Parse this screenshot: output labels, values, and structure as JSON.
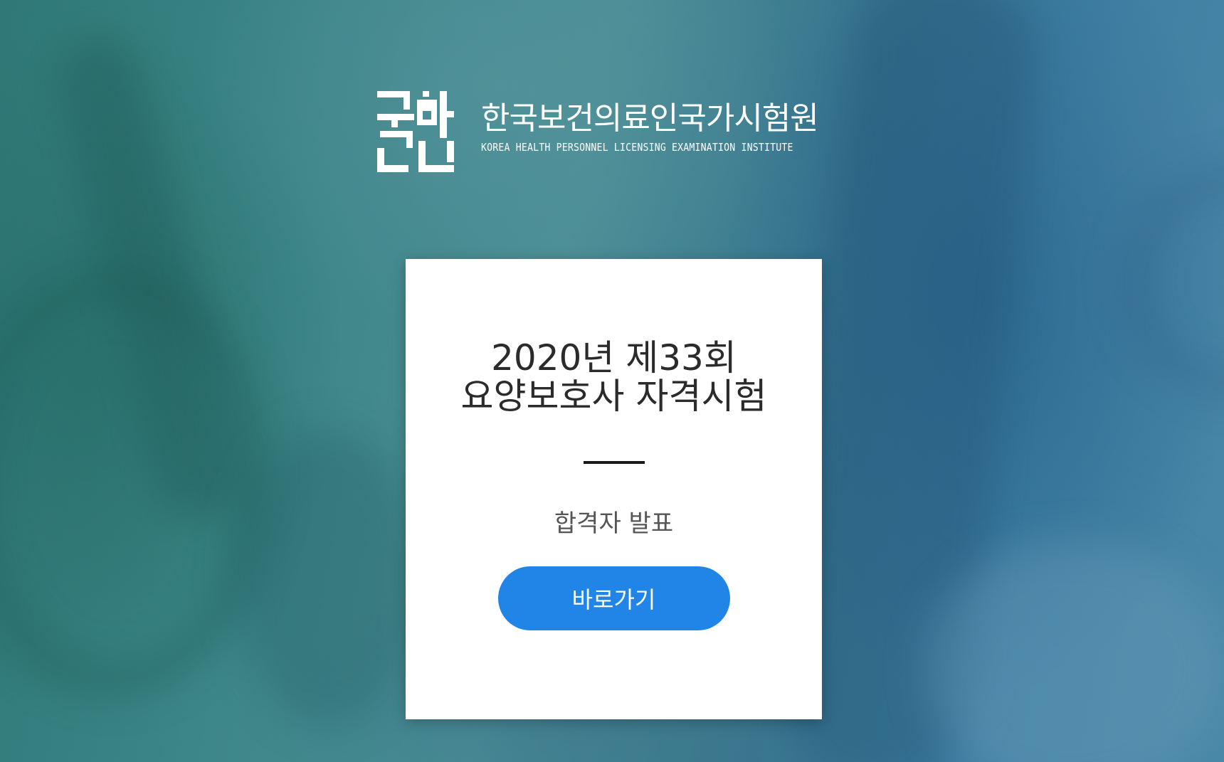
{
  "header": {
    "logo_ko": "한국보건의료인국가시험원",
    "logo_en": "KOREA HEALTH PERSONNEL LICENSING EXAMINATION INSTITUTE",
    "logo_mark_text": "국시원",
    "logo_icon": "kuksiwon-logo-icon"
  },
  "card": {
    "title_line1": "2020년 제33회",
    "title_line2": "요양보호사 자격시험",
    "subtitle": "합격자 발표",
    "button_label": "바로가기"
  },
  "colors": {
    "button": "#2185e8",
    "card_bg": "#ffffff",
    "title_text": "#2b2b2b",
    "divider": "#1a1a1a"
  }
}
